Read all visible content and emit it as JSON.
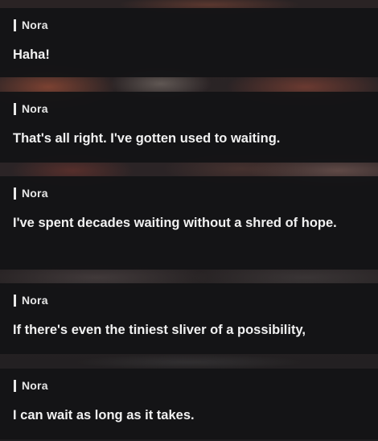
{
  "dialogue_log": [
    {
      "speaker": "Nora",
      "text": "Haha!"
    },
    {
      "speaker": "Nora",
      "text": "That's all right. I've gotten used to waiting."
    },
    {
      "speaker": "Nora",
      "text": "I've spent decades waiting without a shred of hope."
    },
    {
      "speaker": "Nora",
      "text": "If there's even the tiniest sliver of a possibility,"
    },
    {
      "speaker": "Nora",
      "text": "I can wait as long as it takes."
    }
  ],
  "colors": {
    "panel": "#141416",
    "text": "#f1f1f1",
    "speaker_bar": "#e9e9e9"
  }
}
